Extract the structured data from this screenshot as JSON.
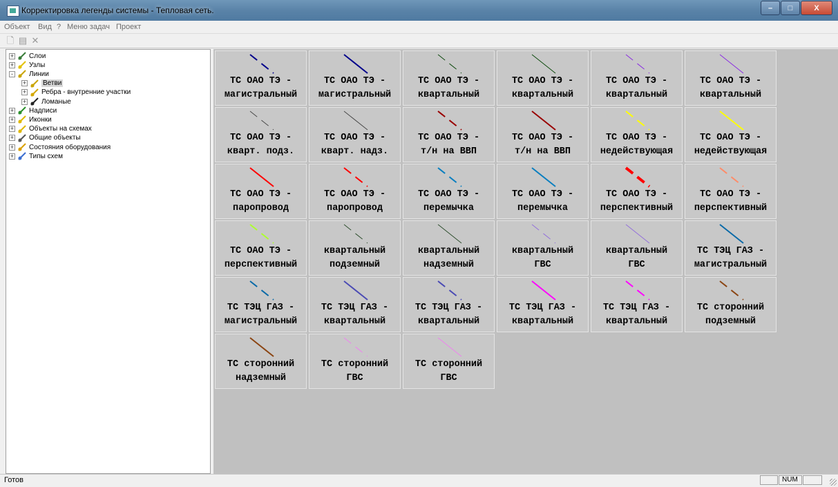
{
  "window": {
    "title": "Корректировка легенды системы - Тепловая сеть."
  },
  "menu": [
    "Объект",
    "Вид",
    "?",
    "Меню задач",
    "Проект"
  ],
  "tree": [
    {
      "label": "Слои",
      "icon": "layers-icon",
      "level": 0,
      "exp": "+"
    },
    {
      "label": "Узлы",
      "icon": "nodes-icon",
      "level": 0,
      "exp": "+"
    },
    {
      "label": "Линии",
      "icon": "lines-icon",
      "level": 0,
      "exp": "-"
    },
    {
      "label": "Ветви",
      "icon": "branch-icon",
      "level": 1,
      "exp": "+",
      "selected": true
    },
    {
      "label": "Ребра - внутренние участки",
      "icon": "edges-icon",
      "level": 1,
      "exp": "+"
    },
    {
      "label": "Ломаные",
      "icon": "polyline-icon",
      "level": 1,
      "exp": "+"
    },
    {
      "label": "Надписи",
      "icon": "labels-icon",
      "level": 0,
      "exp": "+"
    },
    {
      "label": "Иконки",
      "icon": "icons-icon",
      "level": 0,
      "exp": "+"
    },
    {
      "label": "Объекты на схемах",
      "icon": "scheme-objects-icon",
      "level": 0,
      "exp": "+"
    },
    {
      "label": "Общие объекты",
      "icon": "document-icon",
      "level": 0,
      "exp": "+"
    },
    {
      "label": "Состояния оборудования",
      "icon": "equipment-state-icon",
      "level": 0,
      "exp": "+"
    },
    {
      "label": "Типы схем",
      "icon": "scheme-types-icon",
      "level": 0,
      "exp": "+"
    }
  ],
  "legend": [
    {
      "l1": "ТС ОАО ТЭ -",
      "l2": "магистральный",
      "color": "#00008b",
      "style": "dash",
      "w": 2
    },
    {
      "l1": "ТС ОАО ТЭ -",
      "l2": "магистральный",
      "color": "#00008b",
      "style": "solid",
      "w": 2
    },
    {
      "l1": "ТС ОАО ТЭ -",
      "l2": "квартальный",
      "color": "#0d4a0d",
      "style": "dash",
      "w": 1
    },
    {
      "l1": "ТС ОАО ТЭ -",
      "l2": "квартальный",
      "color": "#0d4a0d",
      "style": "solid",
      "w": 1
    },
    {
      "l1": "ТС ОАО ТЭ -",
      "l2": "квартальный",
      "color": "#8a2be2",
      "style": "dash",
      "w": 1
    },
    {
      "l1": "ТС ОАО ТЭ -",
      "l2": "квартальный",
      "color": "#8a2be2",
      "style": "solid",
      "w": 1
    },
    {
      "l1": "ТС ОАО ТЭ -",
      "l2": "кварт. подз.",
      "color": "#4a4a4a",
      "style": "dash",
      "w": 1
    },
    {
      "l1": "ТС ОАО ТЭ -",
      "l2": "кварт. надз.",
      "color": "#4a4a4a",
      "style": "solid",
      "w": 1
    },
    {
      "l1": "ТС ОАО ТЭ -",
      "l2": "т/н на ВВП",
      "color": "#990000",
      "style": "dash",
      "w": 2
    },
    {
      "l1": "ТС ОАО ТЭ -",
      "l2": "т/н на ВВП",
      "color": "#990000",
      "style": "solid",
      "w": 2
    },
    {
      "l1": "ТС ОАО ТЭ -",
      "l2": "недействующая",
      "color": "#ffff00",
      "style": "dash",
      "w": 2
    },
    {
      "l1": "ТС ОАО ТЭ -",
      "l2": "недействующая",
      "color": "#ffff00",
      "style": "solid",
      "w": 2
    },
    {
      "l1": "ТС ОАО ТЭ -",
      "l2": "паропровод",
      "color": "#ff0000",
      "style": "solid",
      "w": 2
    },
    {
      "l1": "ТС ОАО ТЭ -",
      "l2": "паропровод",
      "color": "#ff0000",
      "style": "dash",
      "w": 2
    },
    {
      "l1": "ТС ОАО ТЭ -",
      "l2": "перемычка",
      "color": "#0a7fc0",
      "style": "dash",
      "w": 2
    },
    {
      "l1": "ТС ОАО ТЭ -",
      "l2": "перемычка",
      "color": "#0a7fc0",
      "style": "solid",
      "w": 2
    },
    {
      "l1": "ТС ОАО ТЭ -",
      "l2": "перспективный",
      "color": "#ff0000",
      "style": "dash",
      "w": 4
    },
    {
      "l1": "ТС ОАО ТЭ -",
      "l2": "перспективный",
      "color": "#ff8c69",
      "style": "dash",
      "w": 2
    },
    {
      "l1": "ТС ОАО ТЭ -",
      "l2": "перспективный",
      "color": "#adff2f",
      "style": "dash",
      "w": 2
    },
    {
      "l1": "квартальный",
      "l2": "подземный",
      "color": "#2f4f2f",
      "style": "dash",
      "w": 1
    },
    {
      "l1": "квартальный",
      "l2": "надземный",
      "color": "#2f4f2f",
      "style": "solid",
      "w": 1
    },
    {
      "l1": "квартальный",
      "l2": "ГВС",
      "color": "#9370db",
      "style": "dash",
      "w": 1
    },
    {
      "l1": "квартальный",
      "l2": "ГВС",
      "color": "#9370db",
      "style": "solid",
      "w": 1
    },
    {
      "l1": "ТС ТЭЦ ГАЗ -",
      "l2": "магистральный",
      "color": "#0a6aa8",
      "style": "solid",
      "w": 2
    },
    {
      "l1": "ТС ТЭЦ ГАЗ -",
      "l2": "магистральный",
      "color": "#0a6aa8",
      "style": "dash",
      "w": 2
    },
    {
      "l1": "ТС ТЭЦ ГАЗ -",
      "l2": "квартальный",
      "color": "#4b4bb4",
      "style": "solid",
      "w": 2
    },
    {
      "l1": "ТС ТЭЦ ГАЗ -",
      "l2": "квартальный",
      "color": "#4b4bb4",
      "style": "dash",
      "w": 2
    },
    {
      "l1": "ТС ТЭЦ ГАЗ -",
      "l2": "квартальный",
      "color": "#ff00ff",
      "style": "solid",
      "w": 2
    },
    {
      "l1": "ТС ТЭЦ ГАЗ -",
      "l2": "квартальный",
      "color": "#ff00ff",
      "style": "dash",
      "w": 2
    },
    {
      "l1": "ТС сторонний",
      "l2": "подземный",
      "color": "#8b4513",
      "style": "dash",
      "w": 2
    },
    {
      "l1": "ТС сторонний",
      "l2": "надземный",
      "color": "#8b4513",
      "style": "solid",
      "w": 2
    },
    {
      "l1": "ТС сторонний",
      "l2": "ГВС",
      "color": "#ee82ee",
      "style": "dash",
      "w": 1
    },
    {
      "l1": "ТС сторонний",
      "l2": "ГВС",
      "color": "#ee82ee",
      "style": "solid",
      "w": 1
    }
  ],
  "status": {
    "text": "Готов",
    "num": "NUM"
  }
}
